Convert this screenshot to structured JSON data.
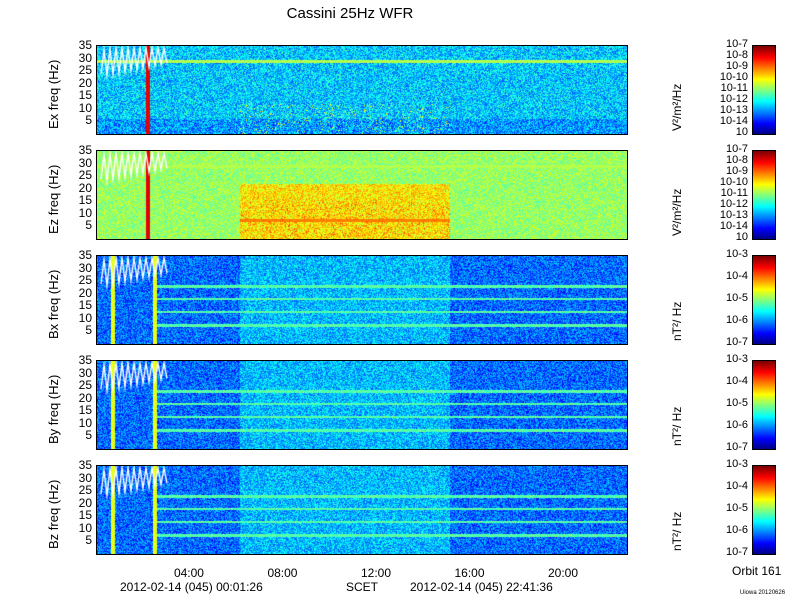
{
  "title": "Cassini 25Hz WFR",
  "chart_data": {
    "type": "heatmap",
    "x_ticks": [
      "04:00",
      "08:00",
      "12:00",
      "16:00",
      "20:00"
    ],
    "x_tick_hours": [
      4,
      8,
      12,
      16,
      20
    ],
    "x_range_hours": [
      0.024,
      22.694
    ],
    "y_ticks": [
      5,
      10,
      15,
      20,
      25,
      30,
      35
    ],
    "y_range": [
      0,
      35
    ],
    "panels": [
      {
        "ylabel": "Ex freq (Hz)",
        "cbar_label": "V²/m²/Hz",
        "cbar_ticks": [
          "10-7",
          "10-8",
          "10-9",
          "10-10",
          "10-11",
          "10-12",
          "10-13",
          "10-14",
          "10"
        ],
        "cbar_range": [
          -15,
          -7
        ]
      },
      {
        "ylabel": "Ez freq (Hz)",
        "cbar_label": "V²/m²/Hz",
        "cbar_ticks": [
          "10-7",
          "10-8",
          "10-9",
          "10-10",
          "10-11",
          "10-12",
          "10-13",
          "10-14",
          "10"
        ],
        "cbar_range": [
          -15,
          -7
        ]
      },
      {
        "ylabel": "Bx freq (Hz)",
        "cbar_label": "nT²/ Hz",
        "cbar_ticks": [
          "10-3",
          "10-4",
          "10-5",
          "10-6",
          "10-7"
        ],
        "cbar_range": [
          -7.5,
          -3
        ]
      },
      {
        "ylabel": "By freq (Hz)",
        "cbar_label": "nT²/ Hz",
        "cbar_ticks": [
          "10-3",
          "10-4",
          "10-5",
          "10-6",
          "10-7"
        ],
        "cbar_range": [
          -7.5,
          -3
        ]
      },
      {
        "ylabel": "Bz freq (Hz)",
        "cbar_label": "nT²/ Hz",
        "cbar_ticks": [
          "10-3",
          "10-4",
          "10-5",
          "10-6",
          "10-7"
        ],
        "cbar_range": [
          -7.5,
          -3
        ]
      }
    ]
  },
  "footer": {
    "start": "2012-02-14 (045) 00:01:26",
    "mid": "SCET",
    "end": "2012-02-14 (045) 22:41:36"
  },
  "orbit": "Orbit 161",
  "stamp": "Uiowa 20120626"
}
